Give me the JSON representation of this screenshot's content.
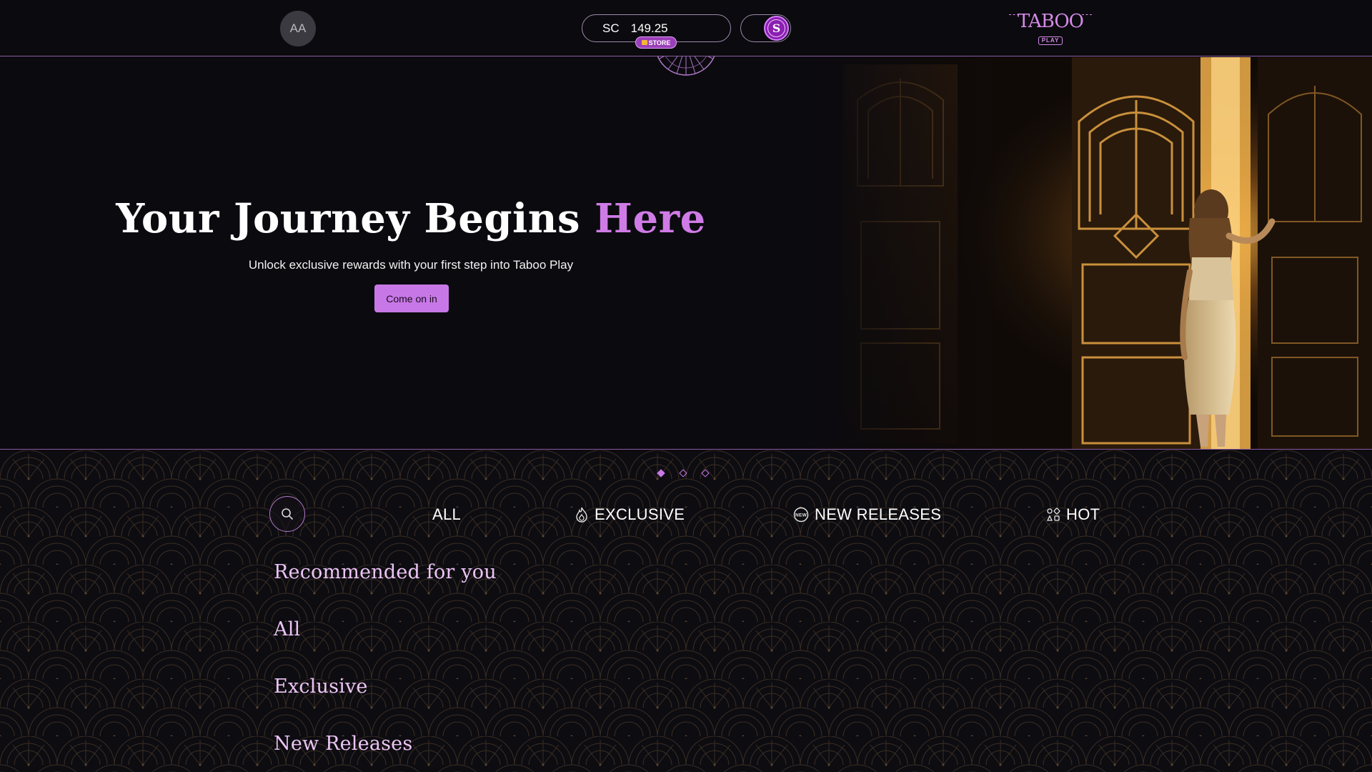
{
  "header": {
    "avatar_initials": "AA",
    "balance_currency": "SC",
    "balance_amount": "149.25",
    "store_label": "STORE",
    "coin_symbol": "S",
    "brand_name": "TABOO",
    "brand_sub": "PLAY"
  },
  "hero": {
    "title_main": "Your Journey Begins ",
    "title_accent": "Here",
    "subtitle": "Unlock exclusive rewards with your first step into Taboo Play",
    "cta_label": "Come on in"
  },
  "carousel": {
    "slide_count": 3,
    "active_slide": 1
  },
  "tabs": [
    {
      "label": "ALL",
      "icon": "none"
    },
    {
      "label": "EXCLUSIVE",
      "icon": "flame-icon"
    },
    {
      "label": "NEW RELEASES",
      "icon": "new-badge-icon",
      "icon_text": "NEW"
    },
    {
      "label": "HOT",
      "icon": "dice-icon"
    }
  ],
  "sections": [
    {
      "title": "Recommended for you"
    },
    {
      "title": "All"
    },
    {
      "title": "Exclusive"
    },
    {
      "title": "New Releases"
    }
  ],
  "colors": {
    "accent": "#c878e6",
    "heading": "#ecc4f5",
    "background": "#0b0a0f",
    "gold": "#c9a25a"
  }
}
